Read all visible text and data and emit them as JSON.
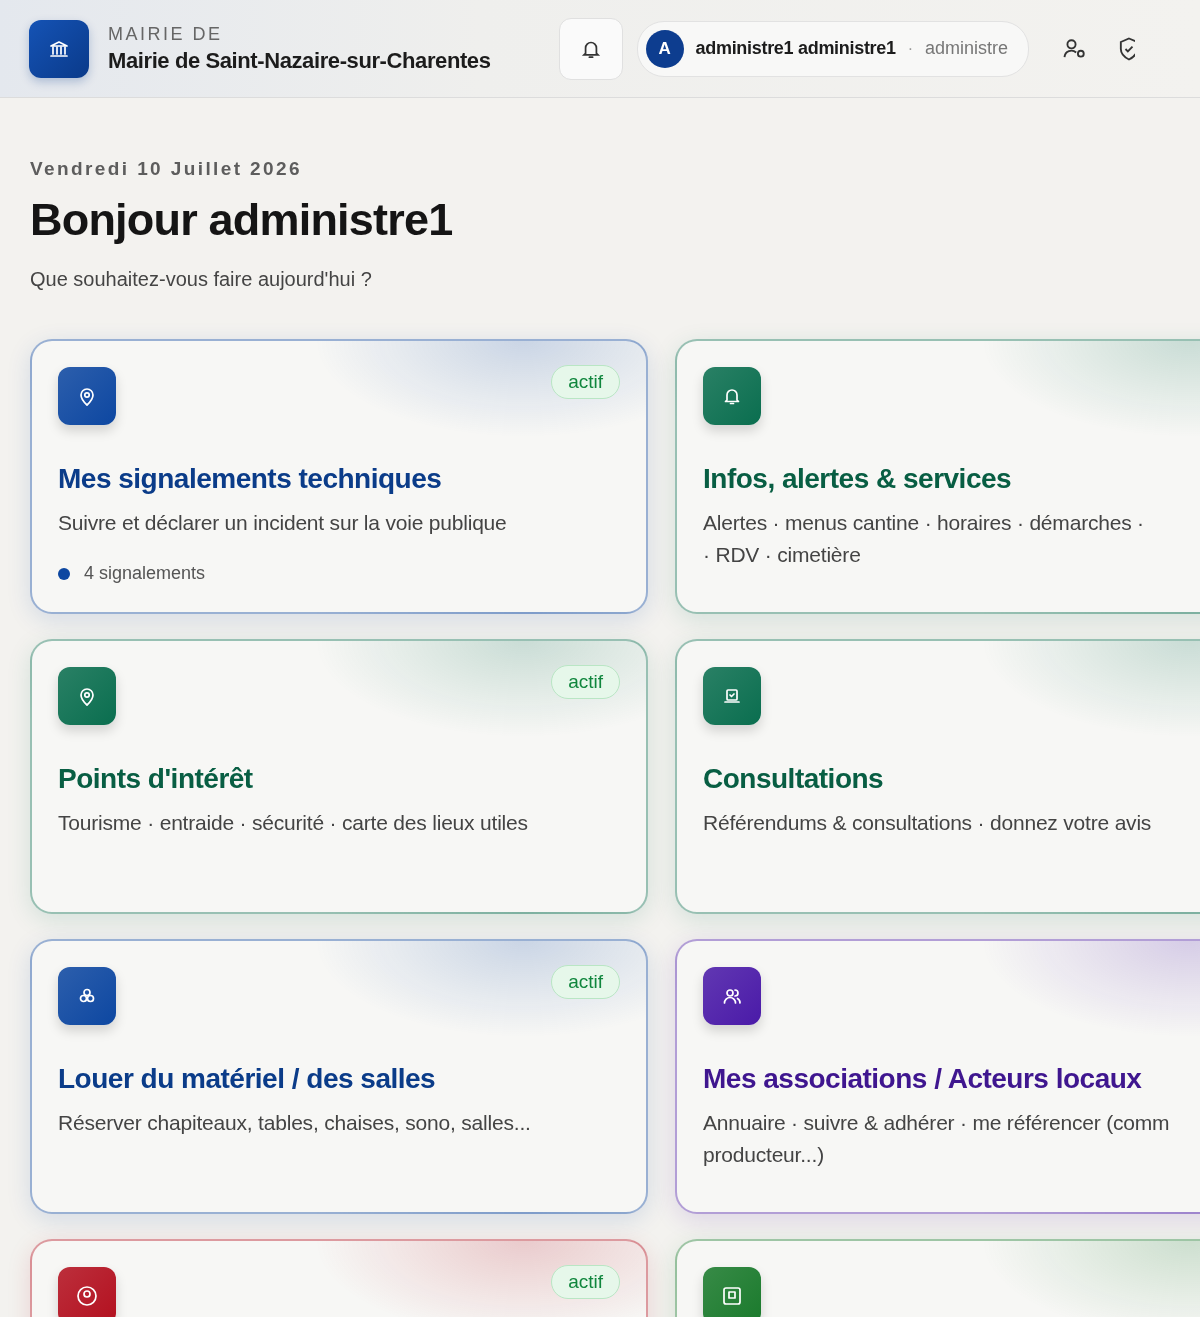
{
  "header": {
    "eyebrow": "MAIRIE DE",
    "title": "Mairie de Saint-Nazaire-sur-Charentes",
    "user": {
      "initial": "A",
      "name": "administre1 administre1",
      "separator": "·",
      "role": "administre"
    }
  },
  "greeting": {
    "date": "Vendredi 10 Juillet 2026",
    "title": "Bonjour administre1",
    "subtitle": "Que souhaitez-vous faire aujourd'hui ?"
  },
  "cards": [
    {
      "title": "Mes signalements techniques",
      "description_lines": [
        "Suivre et déclarer un incident sur la voie publique"
      ],
      "badge": "actif",
      "count": "4 signalements",
      "color": "#0d47a1"
    },
    {
      "title": "Infos, alertes & services",
      "description_lines": [
        "Alertes · menus cantine · horaires · démarches ·",
        "· RDV · cimetière"
      ],
      "color": "#0a6e4f"
    },
    {
      "title": "Points d'intérêt",
      "description_lines": [
        "Tourisme · entraide · sécurité · carte des lieux utiles"
      ],
      "badge": "actif",
      "color": "#0a6e4f"
    },
    {
      "title": "Consultations",
      "description_lines": [
        "Référendums & consultations · donnez votre avis"
      ],
      "color": "#0a6e4f"
    },
    {
      "title": "Louer du matériel / des salles",
      "description_lines": [
        "Réserver chapiteaux, tables, chaises, sono, salles..."
      ],
      "badge": "actif",
      "color": "#0d47a1"
    },
    {
      "title": "Mes associations / Acteurs locaux",
      "description_lines": [
        "Annuaire · suivre & adhérer · me référencer (comm",
        "producteur...)"
      ],
      "color": "#4a1aa8"
    },
    {
      "badge": "actif",
      "color": "#b3101f"
    },
    {
      "color": "#1a7a2c"
    }
  ]
}
